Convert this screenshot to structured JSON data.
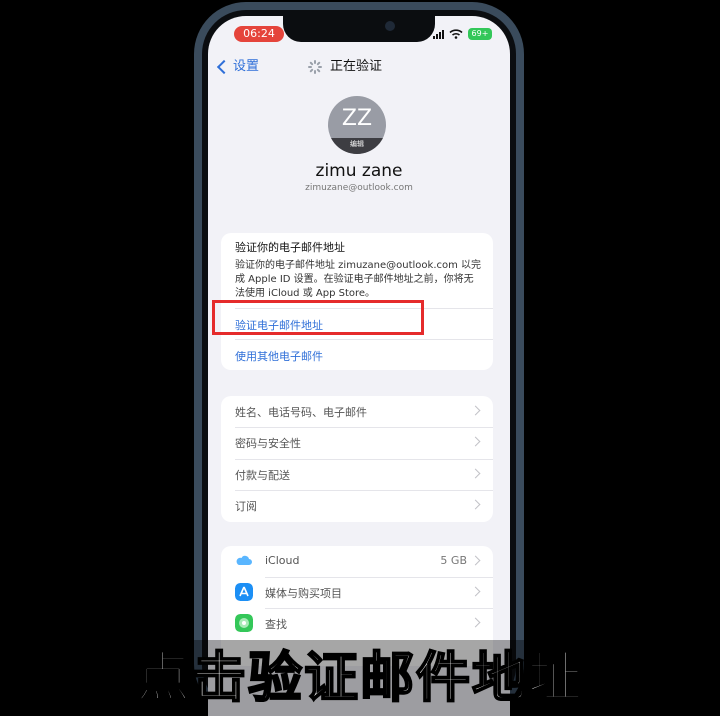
{
  "status_bar": {
    "time": "06:24",
    "battery": "69+"
  },
  "nav": {
    "back_label": "设置",
    "title": "正在验证"
  },
  "profile": {
    "initials": "ZZ",
    "edit_label": "编辑",
    "name": "zimu zane",
    "email": "zimuzane@outlook.com"
  },
  "verify": {
    "title": "验证你的电子邮件地址",
    "description": "验证你的电子邮件地址 zimuzane@outlook.com 以完成 Apple ID 设置。在验证电子邮件地址之前，你将无法使用 iCloud 或 App Store。",
    "primary_link": "验证电子邮件地址",
    "secondary_link": "使用其他电子邮件"
  },
  "settings_menu": [
    {
      "label": "姓名、电话号码、电子邮件"
    },
    {
      "label": "密码与安全性"
    },
    {
      "label": "付款与配送"
    },
    {
      "label": "订阅"
    }
  ],
  "services": [
    {
      "label": "iCloud",
      "value": "5 GB",
      "icon": "icloud-icon",
      "color": "#5ab6ff"
    },
    {
      "label": "媒体与购买项目",
      "value": "",
      "icon": "app-store-icon",
      "color": "#1c8ff5"
    },
    {
      "label": "查找",
      "value": "",
      "icon": "find-my-icon",
      "color": "#34c759"
    }
  ],
  "caption": "点击验证邮件地址",
  "colors": {
    "accent": "#2f6fd8",
    "highlight": "#e52b2b",
    "time_pill": "#e5443b",
    "battery": "#33c759"
  }
}
